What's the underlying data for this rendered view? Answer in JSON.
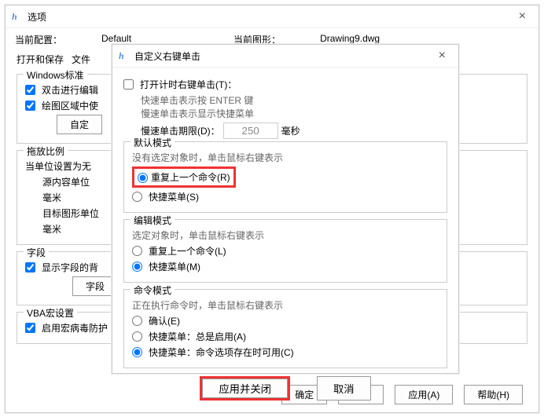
{
  "main": {
    "title": "选项",
    "currentConfigLabel": "当前配置：",
    "currentConfigValue": "Default",
    "currentDrawingLabel": "当前图形：",
    "currentDrawingValue": "Drawing9.dwg",
    "tabs": [
      "打开和保存",
      "文件"
    ],
    "groups": {
      "winstd": {
        "title": "Windows标准",
        "cb1": "双击进行编辑",
        "cb2": "绘图区域中使",
        "btn": "自定"
      },
      "scale": {
        "title": "拖放比例",
        "line1": "当单位设置为无",
        "lbl1": "源内容单位",
        "v1": "毫米",
        "lbl2": "目标图形单位",
        "v2": "毫米"
      },
      "field": {
        "title": "字段",
        "cb": "显示字段的背",
        "btn": "字段"
      },
      "vba": {
        "title": "VBA宏设置",
        "cb": "启用宏病毒防护"
      }
    },
    "footer": {
      "ok": "确定",
      "cancel": "取消",
      "apply": "应用(A)",
      "help": "帮助(H)"
    }
  },
  "child": {
    "title": "自定义右键单击",
    "timer": {
      "cb": "打开计时右键单击(T)：",
      "l1": "快速单击表示按 ENTER 键",
      "l2": "慢速单击表示显示快捷菜单",
      "l3": "慢速单击期限(D)：",
      "val": "250",
      "unit": "毫秒"
    },
    "default": {
      "title": "默认模式",
      "desc": "没有选定对象时，单击鼠标右键表示",
      "r1": "重复上一个命令(R)",
      "r2": "快捷菜单(S)"
    },
    "edit": {
      "title": "编辑模式",
      "desc": "选定对象时，单击鼠标右键表示",
      "r1": "重复上一个命令(L)",
      "r2": "快捷菜单(M)"
    },
    "cmd": {
      "title": "命令模式",
      "desc": "正在执行命令时，单击鼠标右键表示",
      "r1": "确认(E)",
      "r2": "快捷菜单：总是启用(A)",
      "r3": "快捷菜单：命令选项存在时可用(C)"
    },
    "footer": {
      "apply": "应用并关闭",
      "cancel": "取消"
    }
  }
}
